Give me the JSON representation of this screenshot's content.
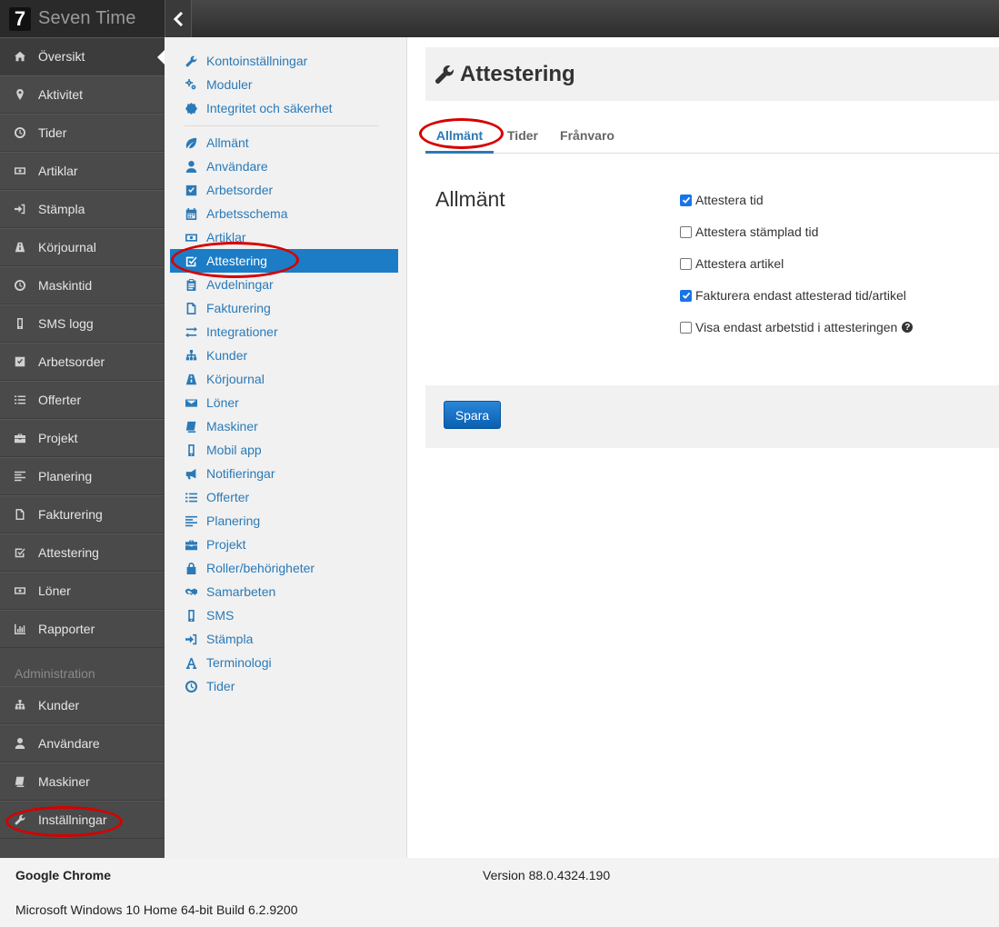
{
  "app": {
    "logo_char": "7",
    "title": "Seven Time"
  },
  "sidebar": {
    "items": [
      {
        "label": "Översikt",
        "icon": "home-icon",
        "active": true
      },
      {
        "label": "Aktivitet",
        "icon": "map-marker-icon"
      },
      {
        "label": "Tider",
        "icon": "clock-icon"
      },
      {
        "label": "Artiklar",
        "icon": "money-icon"
      },
      {
        "label": "Stämpla",
        "icon": "sign-in-icon"
      },
      {
        "label": "Körjournal",
        "icon": "road-icon"
      },
      {
        "label": "Maskintid",
        "icon": "clock-icon"
      },
      {
        "label": "SMS logg",
        "icon": "mobile-icon"
      },
      {
        "label": "Arbetsorder",
        "icon": "check-square-icon"
      },
      {
        "label": "Offerter",
        "icon": "list-icon"
      },
      {
        "label": "Projekt",
        "icon": "briefcase-icon"
      },
      {
        "label": "Planering",
        "icon": "align-left-icon"
      },
      {
        "label": "Fakturering",
        "icon": "file-icon"
      },
      {
        "label": "Attestering",
        "icon": "check-square-o-icon"
      },
      {
        "label": "Löner",
        "icon": "money-icon"
      },
      {
        "label": "Rapporter",
        "icon": "bar-chart-icon"
      }
    ],
    "admin_header": "Administration",
    "admin_items": [
      {
        "label": "Kunder",
        "icon": "sitemap-icon"
      },
      {
        "label": "Användare",
        "icon": "user-icon"
      },
      {
        "label": "Maskiner",
        "icon": "book-icon"
      },
      {
        "label": "Inställningar",
        "icon": "wrench-icon"
      }
    ]
  },
  "submenu": {
    "top_items": [
      {
        "label": "Kontoinställningar",
        "icon": "wrench-icon"
      },
      {
        "label": "Moduler",
        "icon": "cogs-icon"
      },
      {
        "label": "Integritet och säkerhet",
        "icon": "certificate-icon"
      }
    ],
    "items": [
      {
        "label": "Allmänt",
        "icon": "leaf-icon"
      },
      {
        "label": "Användare",
        "icon": "user-icon"
      },
      {
        "label": "Arbetsorder",
        "icon": "check-square-icon"
      },
      {
        "label": "Arbetsschema",
        "icon": "calendar-icon"
      },
      {
        "label": "Artiklar",
        "icon": "money-icon"
      },
      {
        "label": "Attestering",
        "icon": "check-square-o-icon",
        "active": true
      },
      {
        "label": "Avdelningar",
        "icon": "clipboard-icon"
      },
      {
        "label": "Fakturering",
        "icon": "file-icon"
      },
      {
        "label": "Integrationer",
        "icon": "exchange-icon"
      },
      {
        "label": "Kunder",
        "icon": "sitemap-icon"
      },
      {
        "label": "Körjournal",
        "icon": "road-icon"
      },
      {
        "label": "Löner",
        "icon": "envelope-icon"
      },
      {
        "label": "Maskiner",
        "icon": "book-icon"
      },
      {
        "label": "Mobil app",
        "icon": "mobile-icon"
      },
      {
        "label": "Notifieringar",
        "icon": "bullhorn-icon"
      },
      {
        "label": "Offerter",
        "icon": "list-icon"
      },
      {
        "label": "Planering",
        "icon": "align-left-icon"
      },
      {
        "label": "Projekt",
        "icon": "briefcase-icon"
      },
      {
        "label": "Roller/behörigheter",
        "icon": "lock-icon"
      },
      {
        "label": "Samarbeten",
        "icon": "handshake-icon"
      },
      {
        "label": "SMS",
        "icon": "mobile-icon"
      },
      {
        "label": "Stämpla",
        "icon": "sign-in-icon"
      },
      {
        "label": "Terminologi",
        "icon": "font-icon"
      },
      {
        "label": "Tider",
        "icon": "clock-icon"
      }
    ]
  },
  "main": {
    "title": "Attestering",
    "tabs": [
      {
        "label": "Allmänt",
        "active": true
      },
      {
        "label": "Tider"
      },
      {
        "label": "Frånvaro"
      }
    ],
    "section_title": "Allmänt",
    "options": [
      {
        "label": "Attestera tid",
        "checked": true
      },
      {
        "label": "Attestera stämplad tid",
        "checked": false
      },
      {
        "label": "Attestera artikel",
        "checked": false
      },
      {
        "label": "Fakturera endast attesterad tid/artikel",
        "checked": true
      },
      {
        "label": "Visa endast arbetstid i attesteringen",
        "checked": false,
        "help": "?"
      }
    ],
    "save_label": "Spara"
  },
  "footer": {
    "browser": "Google Chrome",
    "version": "Version 88.0.4324.190",
    "os": "Microsoft Windows 10 Home 64-bit Build 6.2.9200"
  },
  "colors": {
    "accent": "#1c7cc6",
    "sidebar": "#4a4a4a",
    "annotation": "#d60000"
  }
}
